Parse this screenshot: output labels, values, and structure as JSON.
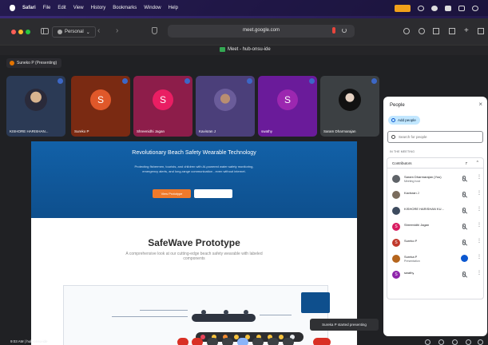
{
  "menubar": {
    "app_name": "Safari",
    "items": [
      "File",
      "Edit",
      "View",
      "History",
      "Bookmarks",
      "Window",
      "Help"
    ]
  },
  "toolbar": {
    "profile_label": "Personal",
    "profile_chevron": "⌄",
    "back": "‹",
    "forward": "›",
    "url": "meet.google.com",
    "new_tab": "+"
  },
  "tab": {
    "label": "Meet - hub-onsu-ide"
  },
  "meet": {
    "presenting_label": "Suneko P (Presenting)",
    "participants": [
      {
        "name": "KISHORE HARISHAN...",
        "initial": "",
        "color": "#2b3a55"
      },
      {
        "name": "Sureko P",
        "initial": "S",
        "color": "#b7410e"
      },
      {
        "name": "Shreenidhi Jagan",
        "initial": "S",
        "color": "#c2185b"
      },
      {
        "name": "Kavisran J",
        "initial": "",
        "color": "#5b4a8f"
      },
      {
        "name": "swathy",
        "initial": "S",
        "color": "#7b1fa2"
      },
      {
        "name": "Saram Dharmarajan",
        "initial": "",
        "color": "#3c4043"
      }
    ],
    "toast": "Sureka P started presenting",
    "time_label": "9:03 AM | hub-onsu-ide"
  },
  "slide": {
    "hero_title": "Revolutionary Beach Safety Wearable Technology",
    "hero_text": "Protecting fishermen, tourists, and children with AI-powered water safety monitoring, emergency alerts, and long-range communication - even without internet.",
    "hero_button": "View Prototype",
    "proto_title": "SafeWave Prototype",
    "proto_text": "A comprehensive look at our cutting-edge beach safety wearable with labeled components"
  },
  "people_panel": {
    "title": "People",
    "close": "×",
    "add_label": "Add people",
    "search_placeholder": "Search for people",
    "section_label": "IN THE MEETING",
    "contributors_label": "Contributors",
    "contributors_count": "7",
    "chevron": "^",
    "more": "⋮",
    "people": [
      {
        "name": "Saram Dharmarajan (You)",
        "sub": "Meeting host",
        "initial": "",
        "color": "#5f6368",
        "speaking": false
      },
      {
        "name": "Kavisran J",
        "sub": "",
        "initial": "",
        "color": "#7a6c5d",
        "speaking": false
      },
      {
        "name": "KISHORE HARISHAN KU...",
        "sub": "",
        "initial": "",
        "color": "#3d4b5e",
        "speaking": false
      },
      {
        "name": "Shreenidhi Jagan",
        "sub": "",
        "initial": "S",
        "color": "#d81b60",
        "speaking": false
      },
      {
        "name": "Sureko P",
        "sub": "",
        "initial": "S",
        "color": "#c0392b",
        "speaking": false
      },
      {
        "name": "Sureka P",
        "sub": "Presentation",
        "initial": "",
        "color": "#b5651d",
        "speaking": true
      },
      {
        "name": "swathy",
        "sub": "",
        "initial": "S",
        "color": "#8e24aa",
        "speaking": false
      }
    ]
  },
  "colors": {
    "meet_bg": "#202124",
    "accent_blue": "#0b57d0",
    "hangup_red": "#d93025",
    "hero_blue": "#0e4f8d",
    "button_orange": "#f07a2b"
  }
}
